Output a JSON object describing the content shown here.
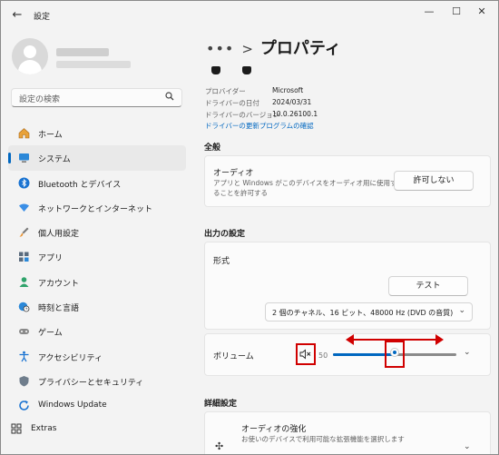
{
  "titlebar": {
    "title": "設定"
  },
  "sidebar": {
    "search_placeholder": "設定の検索",
    "items": [
      {
        "label": "ホーム",
        "icon": "home-icon",
        "active": false
      },
      {
        "label": "システム",
        "icon": "monitor-icon",
        "active": true
      },
      {
        "label": "Bluetooth とデバイス",
        "icon": "bluetooth-icon",
        "active": false
      },
      {
        "label": "ネットワークとインターネット",
        "icon": "wifi-icon",
        "active": false
      },
      {
        "label": "個人用設定",
        "icon": "brush-icon",
        "active": false
      },
      {
        "label": "アプリ",
        "icon": "apps-icon",
        "active": false
      },
      {
        "label": "アカウント",
        "icon": "account-icon",
        "active": false
      },
      {
        "label": "時刻と言語",
        "icon": "globe-clock-icon",
        "active": false
      },
      {
        "label": "ゲーム",
        "icon": "gamepad-icon",
        "active": false
      },
      {
        "label": "アクセシビリティ",
        "icon": "accessibility-icon",
        "active": false
      },
      {
        "label": "プライバシーとセキュリティ",
        "icon": "shield-icon",
        "active": false
      },
      {
        "label": "Windows Update",
        "icon": "update-icon",
        "active": false
      }
    ],
    "extras_label": "Extras"
  },
  "header": {
    "dots": "•••",
    "separator": ">",
    "title": "プロパティ"
  },
  "properties": {
    "provider_label": "プロバイダー",
    "provider_value": "Microsoft",
    "date_label": "ドライバーの日付",
    "date_value": "2024/03/31",
    "version_label": "ドライバーのバージョン",
    "version_value": "10.0.26100.1",
    "update_link": "ドライバーの更新プログラムの確認"
  },
  "general": {
    "heading": "全般",
    "audio_title": "オーディオ",
    "audio_desc_1": "アプリと Windows がこのデバイスをオーディオ用に使用す",
    "audio_desc_2": "ることを許可する",
    "deny_button": "許可しない"
  },
  "output": {
    "heading": "出力の設定",
    "format_label": "形式",
    "test_button": "テスト",
    "format_value": "2 個のチャネル、16 ビット、48000 Hz (DVD の音質)",
    "volume_label": "ボリューム",
    "volume_value": "50",
    "volume_fraction": 0.5
  },
  "advanced": {
    "heading": "詳細設定",
    "enhance_title": "オーディオの強化",
    "enhance_desc": "お使いのデバイスで利用可能な拡張機能を選択します"
  },
  "colors": {
    "accent": "#0067c0",
    "annotation_red": "#d00000"
  }
}
